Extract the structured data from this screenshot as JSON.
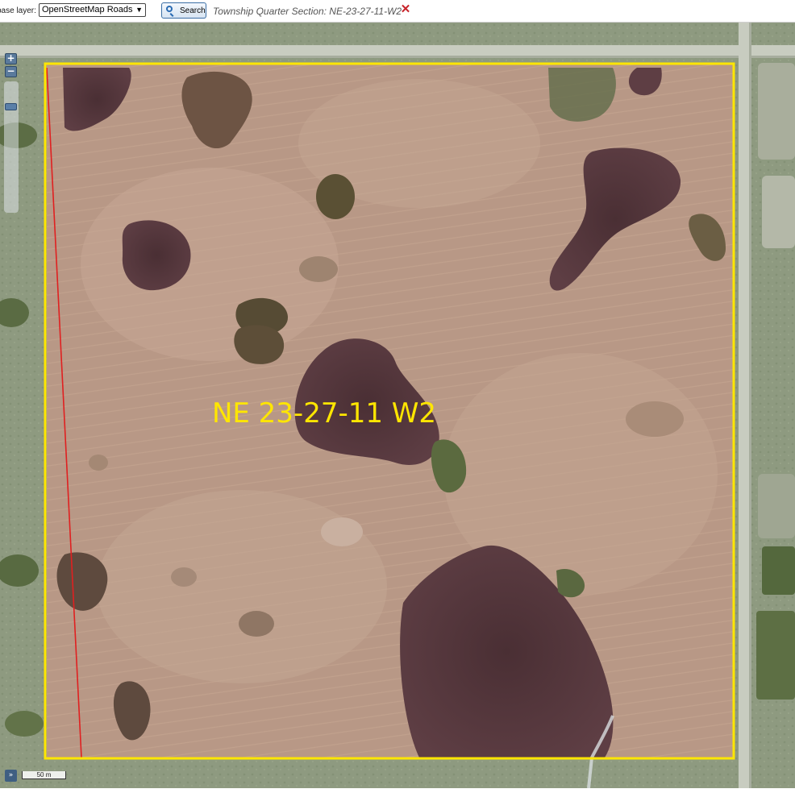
{
  "toolbar": {
    "base_layer_label": "base layer:",
    "base_layer_selected": "OpenStreetMap Roads",
    "search_label": "Search",
    "search_icon": "magnifier-icon",
    "section_text": "Township Quarter Section: NE-23-27-11-W2",
    "close_icon": "close-icon"
  },
  "map": {
    "parcel_label": "NE 23-27-11 W2",
    "parcel_border_color": "#ffe600",
    "parcel_label_color": "#ffe600",
    "survey_line_color": "#e02020",
    "zoom_in_label": "+",
    "zoom_out_label": "−",
    "layers_switcher_label": "»",
    "scale_label": "50 m"
  }
}
